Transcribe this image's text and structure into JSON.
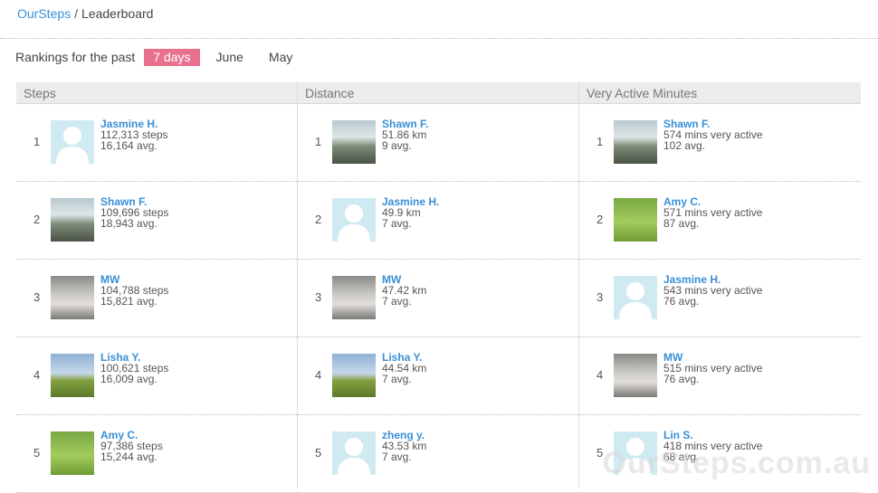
{
  "breadcrumb": {
    "home": "OurSteps",
    "separator": "/",
    "current": "Leaderboard"
  },
  "filter": {
    "label": "Rankings for the past",
    "options": [
      "7 days",
      "June",
      "May"
    ],
    "selected": "7 days"
  },
  "colors": {
    "accent": "#e8708f",
    "link": "#3a8fd6",
    "header_bg": "#ececec"
  },
  "columns": [
    {
      "title": "Steps",
      "rows": [
        {
          "rank": "1",
          "name": "Jasmine H.",
          "value": "112,313 steps",
          "avg": "16,164 avg.",
          "avatar": "placeholder-avatar"
        },
        {
          "rank": "2",
          "name": "Shawn F.",
          "value": "109,696 steps",
          "avg": "18,943 avg.",
          "avatar": "photo-shawn"
        },
        {
          "rank": "3",
          "name": "MW",
          "value": "104,788 steps",
          "avg": "15,821 avg.",
          "avatar": "photo-mw"
        },
        {
          "rank": "4",
          "name": "Lisha Y.",
          "value": "100,621 steps",
          "avg": "16,009 avg.",
          "avatar": "photo-lisha"
        },
        {
          "rank": "5",
          "name": "Amy C.",
          "value": "97,386 steps",
          "avg": "15,244 avg.",
          "avatar": "photo-amy"
        }
      ]
    },
    {
      "title": "Distance",
      "rows": [
        {
          "rank": "1",
          "name": "Shawn F.",
          "value": "51.86 km",
          "avg": "9 avg.",
          "avatar": "photo-shawn"
        },
        {
          "rank": "2",
          "name": "Jasmine H.",
          "value": "49.9 km",
          "avg": "7 avg.",
          "avatar": "placeholder-avatar"
        },
        {
          "rank": "3",
          "name": "MW",
          "value": "47.42 km",
          "avg": "7 avg.",
          "avatar": "photo-mw"
        },
        {
          "rank": "4",
          "name": "Lisha Y.",
          "value": "44.54 km",
          "avg": "7 avg.",
          "avatar": "photo-lisha"
        },
        {
          "rank": "5",
          "name": "zheng y.",
          "value": "43.53 km",
          "avg": "7 avg.",
          "avatar": "placeholder-avatar"
        }
      ]
    },
    {
      "title": "Very Active Minutes",
      "rows": [
        {
          "rank": "1",
          "name": "Shawn F.",
          "value": "574 mins very active",
          "avg": "102 avg.",
          "avatar": "photo-shawn"
        },
        {
          "rank": "2",
          "name": "Amy C.",
          "value": "571 mins very active",
          "avg": "87 avg.",
          "avatar": "photo-amy"
        },
        {
          "rank": "3",
          "name": "Jasmine H.",
          "value": "543 mins very active",
          "avg": "76 avg.",
          "avatar": "placeholder-avatar"
        },
        {
          "rank": "4",
          "name": "MW",
          "value": "515 mins very active",
          "avg": "76 avg.",
          "avatar": "photo-mw"
        },
        {
          "rank": "5",
          "name": "Lin S.",
          "value": "418 mins very active",
          "avg": "68 avg.",
          "avatar": "placeholder-avatar"
        }
      ]
    }
  ],
  "watermark": "OurSteps.com.au"
}
